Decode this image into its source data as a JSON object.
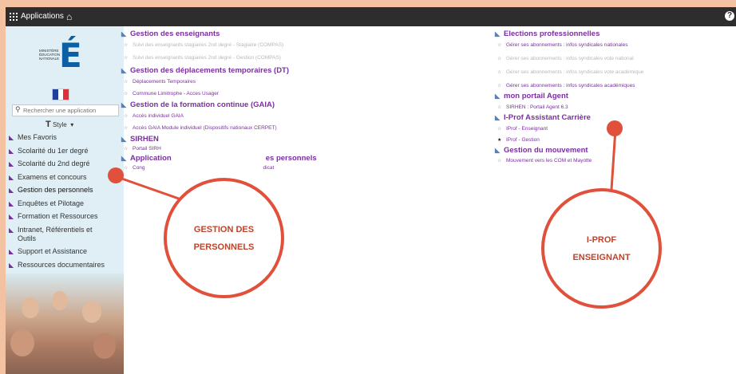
{
  "topbar": {
    "apps_label": "Applications",
    "home_icon": "home-icon",
    "help_icon": "help-icon"
  },
  "sidebar": {
    "logo_text": "MINISTÈRE ÉDUCATION NATIONALE",
    "search_placeholder": "Rechercher une application",
    "style_label": "Style",
    "items": [
      {
        "label": "Mes Favoris",
        "icon": "nav-icon"
      },
      {
        "label": "Scolarité du 1er degré",
        "icon": "nav-icon"
      },
      {
        "label": "Scolarité du 2nd degré",
        "icon": "nav-icon"
      },
      {
        "label": "Examens et concours",
        "icon": "nav-icon"
      },
      {
        "label": "Gestion des personnels",
        "icon": "nav-icon"
      },
      {
        "label": "Enquêtes et Pilotage",
        "icon": "nav-icon"
      },
      {
        "label": "Formation et Ressources",
        "icon": "nav-icon"
      },
      {
        "label": "Intranet, Référentiels et Outils",
        "icon": "nav-icon"
      },
      {
        "label": "Support et Assistance",
        "icon": "nav-icon"
      },
      {
        "label": "Ressources documentaires",
        "icon": "nav-icon"
      }
    ]
  },
  "left_column": [
    {
      "title": "Gestion des enseignants",
      "links": [
        {
          "label": "Suivi des enseignants stagiaires 2nd degré - Stagiaire (COMPAS)",
          "disabled": true
        },
        {
          "label": "Suivi des enseignants stagiaires 2nd degré - Gestion (COMPAS)",
          "disabled": true
        }
      ]
    },
    {
      "title": "Gestion des déplacements temporaires (DT)",
      "links": [
        {
          "label": "Déplacements Temporaires",
          "disabled": false
        },
        {
          "label": "Commune Limitrophe - Acces Usager",
          "disabled": false
        }
      ]
    },
    {
      "title": "Gestion de la formation continue (GAIA)",
      "links": [
        {
          "label": "Accès individuel GAIA",
          "disabled": false
        },
        {
          "label": "Accès GAIA Module individuel (Dispositifs nationaux CERPET)",
          "disabled": false
        }
      ]
    },
    {
      "title": "SIRHEN",
      "links": [
        {
          "label": "Portail SIRH",
          "disabled": false
        }
      ]
    },
    {
      "title": "Application",
      "title_tail": "es personnels",
      "links": [
        {
          "label": "Cong",
          "label_tail": "dicat",
          "disabled": false
        }
      ]
    }
  ],
  "right_column": [
    {
      "title": "Elections professionnelles",
      "links": [
        {
          "label": "Gérer ses abonnements : infos syndicales nationales",
          "disabled": false
        },
        {
          "label": "Gérer ses abonnements : infos syndicales vote national",
          "disabled": true
        },
        {
          "label": "Gérer ses abonnements : infos syndicales vote académique",
          "disabled": true
        },
        {
          "label": "Gérer ses abonnements : infos syndicales académiques",
          "disabled": false
        }
      ]
    },
    {
      "title": "mon portail Agent",
      "links": [
        {
          "label": "SIRHEN : Portail Agent 6.3",
          "disabled": false
        }
      ]
    },
    {
      "title": "I-Prof Assistant Carrière",
      "links": [
        {
          "label": "IProf - Enseignant",
          "disabled": false
        },
        {
          "label": "IProf - Gestion",
          "disabled": false,
          "starred": true
        }
      ]
    },
    {
      "title": "Gestion du mouvement",
      "links": [
        {
          "label": "Mouvement vers les COM et Mayotte",
          "disabled": false
        }
      ]
    }
  ],
  "callouts": {
    "left_line1": "GESTION DES",
    "left_line2": "PERSONNELS",
    "right_line1": "I-PROF",
    "right_line2": "ENSEIGNANT"
  },
  "colors": {
    "accent": "#7a2fa0",
    "callout": "#e0503a",
    "background": "#f3c2a3",
    "topbar": "#2d2d2d",
    "sidebar": "#dfeff5"
  }
}
